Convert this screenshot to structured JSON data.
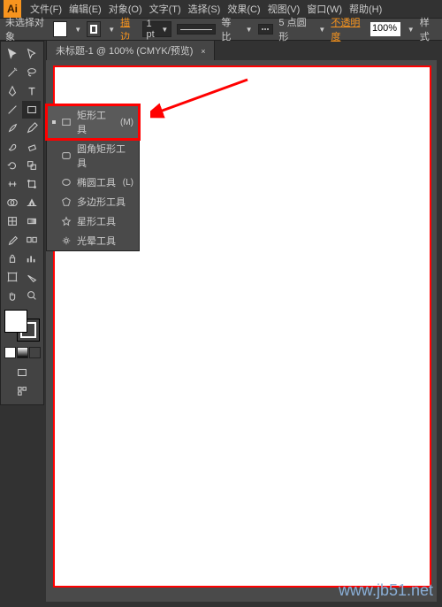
{
  "app_logo": "Ai",
  "menubar": [
    "文件(F)",
    "编辑(E)",
    "对象(O)",
    "文字(T)",
    "选择(S)",
    "效果(C)",
    "视图(V)",
    "窗口(W)",
    "帮助(H)"
  ],
  "propbar": {
    "no_selection": "未选择对象",
    "stroke_link": "描边",
    "stroke_weight": "1 pt",
    "uniform": "等比",
    "dash_points": "5 点圆形",
    "opacity_label": "不透明度",
    "opacity_value": "100%",
    "style_label": "样式"
  },
  "doctab": {
    "title": "未标题-1 @ 100% (CMYK/预览)",
    "close": "×"
  },
  "flyout": [
    {
      "label": "矩形工具",
      "key": "(M)",
      "sel": true,
      "highlight": true,
      "icon": "rect"
    },
    {
      "label": "圆角矩形工具",
      "key": "",
      "icon": "roundrect"
    },
    {
      "label": "椭圆工具",
      "key": "(L)",
      "icon": "ellipse"
    },
    {
      "label": "多边形工具",
      "key": "",
      "icon": "polygon"
    },
    {
      "label": "星形工具",
      "key": "",
      "icon": "star"
    },
    {
      "label": "光晕工具",
      "key": "",
      "icon": "flare"
    }
  ],
  "watermark": "www.jb51.net"
}
